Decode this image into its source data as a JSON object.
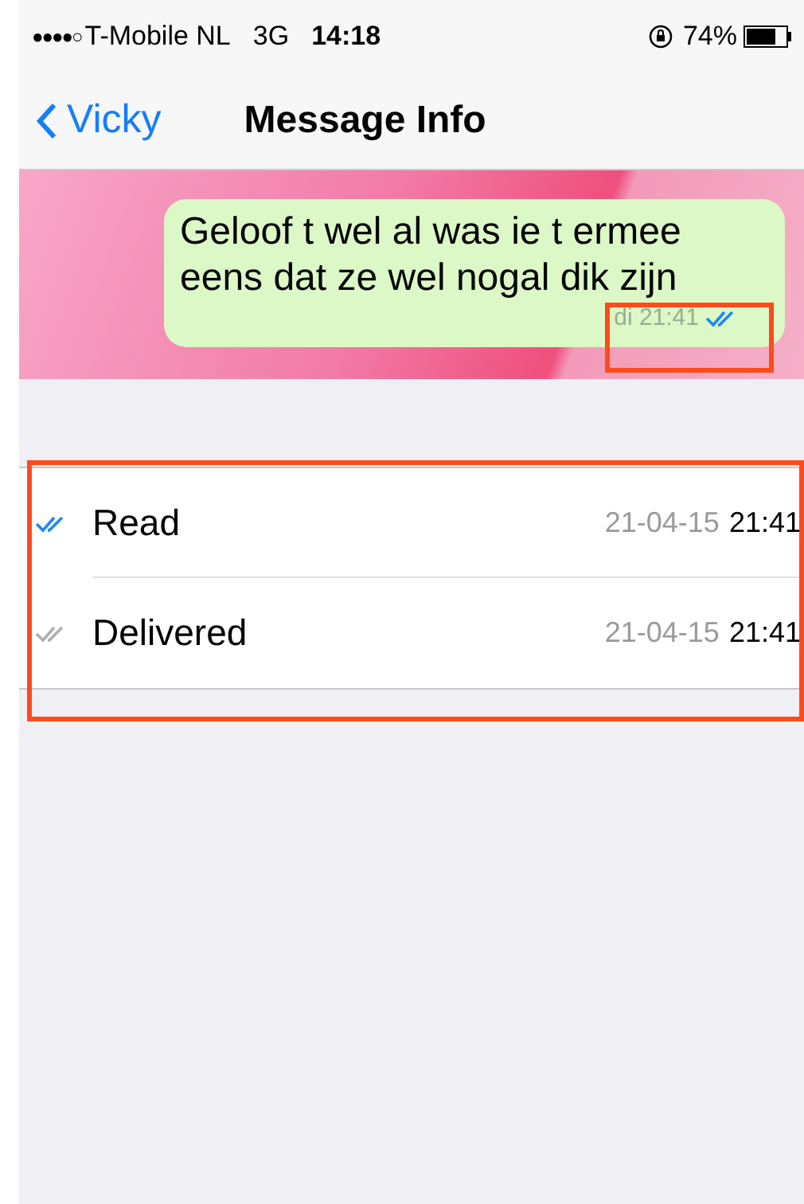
{
  "status_bar": {
    "signal": "●●●●○",
    "carrier": "T-Mobile NL",
    "network": "3G",
    "time": "14:18",
    "battery": "74%"
  },
  "nav": {
    "back": "Vicky",
    "title": "Message Info"
  },
  "message": {
    "text": "Geloof t wel al was ie t ermee eens dat ze wel nogal dik zijn",
    "time": "di 21:41",
    "read": true
  },
  "receipts": [
    {
      "label": "Read",
      "date": "21-04-15",
      "time": "21:41",
      "color": "#1e88f0"
    },
    {
      "label": "Delivered",
      "date": "21-04-15",
      "time": "21:41",
      "color": "#b0b0b0"
    }
  ]
}
